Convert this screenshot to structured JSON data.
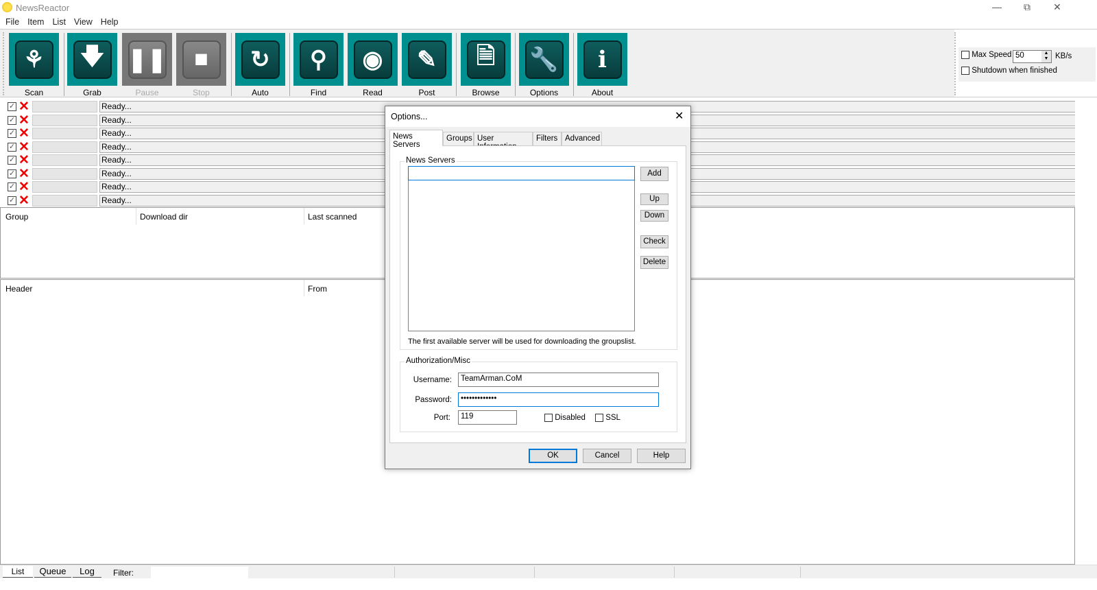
{
  "app": {
    "title": "NewsReactor"
  },
  "menu": [
    "File",
    "Item",
    "List",
    "View",
    "Help"
  ],
  "toolbar": {
    "buttons": [
      {
        "label": "Scan",
        "icon": "binoculars-icon",
        "enabled": true
      },
      {
        "label": "Grab",
        "icon": "download-arrow-icon",
        "enabled": true
      },
      {
        "label": "Pause",
        "icon": "pause-icon",
        "enabled": false
      },
      {
        "label": "Stop",
        "icon": "stop-icon",
        "enabled": false
      },
      {
        "label": "Auto",
        "icon": "spiral-icon",
        "enabled": true
      },
      {
        "label": "Find",
        "icon": "magnifier-icon",
        "enabled": true
      },
      {
        "label": "Read",
        "icon": "eye-icon",
        "enabled": true
      },
      {
        "label": "Post",
        "icon": "pencil-paper-icon",
        "enabled": true
      },
      {
        "label": "Browse",
        "icon": "documents-icon",
        "enabled": true
      },
      {
        "label": "Options",
        "icon": "wrench-icon",
        "enabled": true
      },
      {
        "label": "About",
        "icon": "info-icon",
        "enabled": true
      }
    ]
  },
  "speed": {
    "max_speed_label": "Max Speed",
    "max_speed_value": "50",
    "unit": "KB/s",
    "shutdown_label": "Shutdown when finished",
    "max_speed_checked": false,
    "shutdown_checked": false
  },
  "connections": [
    "Ready...",
    "Ready...",
    "Ready...",
    "Ready...",
    "Ready...",
    "Ready...",
    "Ready...",
    "Ready..."
  ],
  "groups_table": {
    "columns": [
      "Group",
      "Download dir",
      "Last scanned"
    ]
  },
  "headers_table": {
    "columns": [
      "Header",
      "From"
    ]
  },
  "bottom": {
    "tabs": [
      "List",
      "Queue",
      "Log"
    ],
    "filter_label": "Filter:",
    "filter_value": ""
  },
  "dialog": {
    "title": "Options...",
    "tabs": [
      "News Servers",
      "Groups",
      "User Information",
      "Filters",
      "Advanced"
    ],
    "active_tab": "News Servers",
    "servers_group": "News Servers",
    "server_input": "",
    "buttons": {
      "add": "Add",
      "up": "Up",
      "down": "Down",
      "check": "Check",
      "delete": "Delete"
    },
    "note": "The first available server will be used for downloading the groupslist.",
    "auth_group": "Authorization/Misc",
    "username_label": "Username:",
    "username": "TeamArman.CoM",
    "password_label": "Password:",
    "password": "•••••••••••••",
    "port_label": "Port:",
    "port": "119",
    "disabled_label": "Disabled",
    "ssl_label": "SSL",
    "ok": "OK",
    "cancel": "Cancel",
    "help": "Help"
  },
  "colors": {
    "toolbar_teal": "#008f8f",
    "accent": "#0078d7",
    "error_x": "#e00000"
  }
}
